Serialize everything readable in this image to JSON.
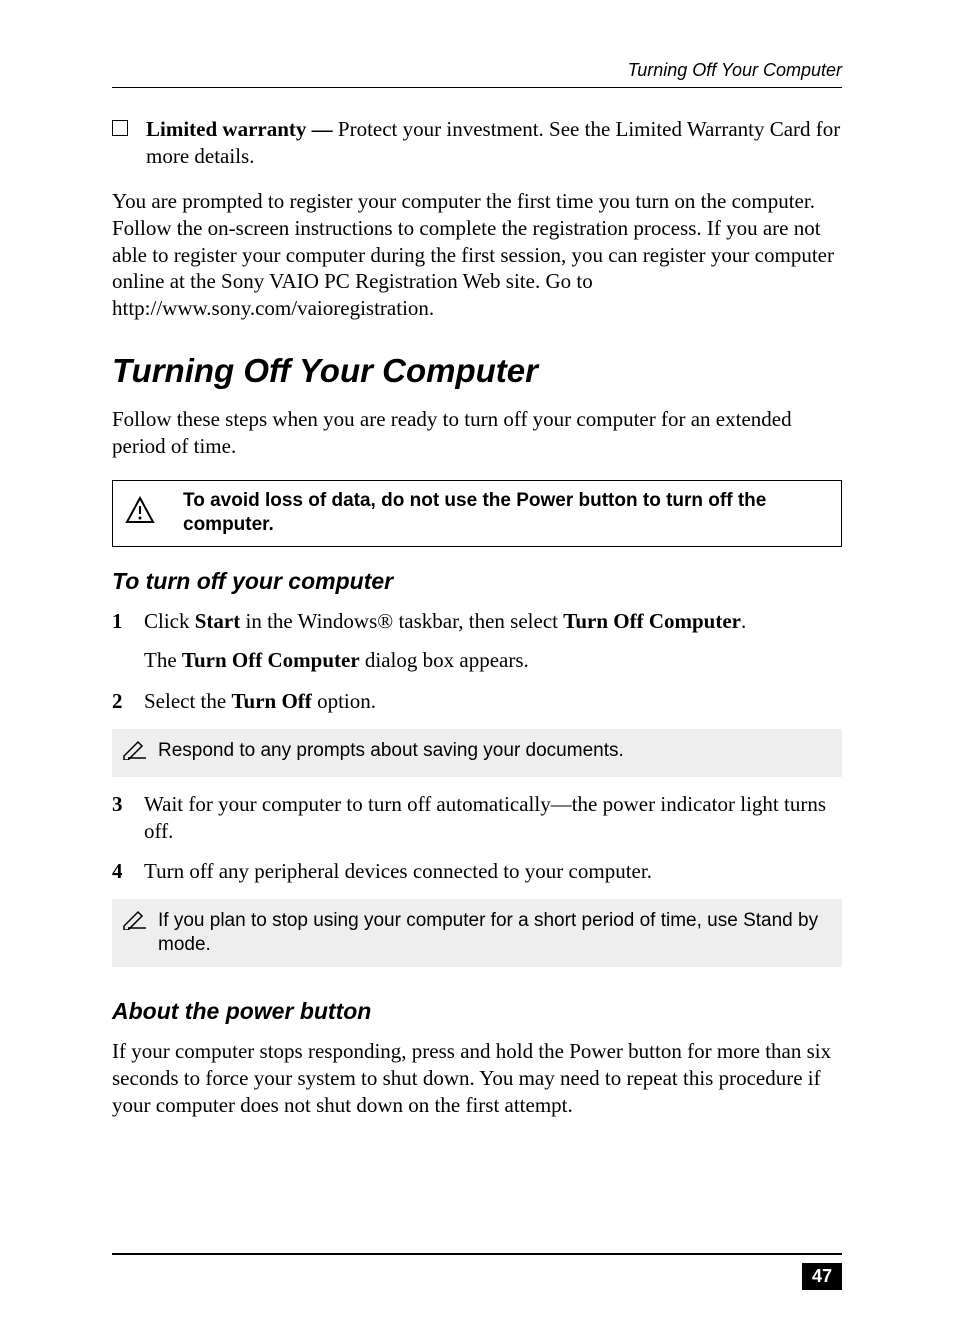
{
  "runningHead": "Turning Off Your Computer",
  "bullet": {
    "lead": "Limited warranty — ",
    "rest": "Protect your investment. See the Limited Warranty Card for more details."
  },
  "intro": "You are prompted to register your computer the first time you turn on the computer. Follow the on-screen instructions to complete the registration process. If you are not able to register your computer during the first session, you can register your computer online at the Sony VAIO PC Registration Web site. Go to http://www.sony.com/vaioregistration.",
  "h1": "Turning Off Your Computer",
  "h1_intro": "Follow these steps when you are ready to turn off your computer for an extended period of time.",
  "warning": "To avoid loss of data, do not use the Power button to turn off the computer.",
  "h2a": "To turn off your computer",
  "steps": {
    "s1_pre": "Click ",
    "s1_b1": "Start",
    "s1_mid": " in the Windows® taskbar, then select ",
    "s1_b2": "Turn Off Computer",
    "s1_post": ".",
    "s1_sub_pre": "The ",
    "s1_sub_b": "Turn Off Computer",
    "s1_sub_post": " dialog box appears.",
    "s2_pre": "Select the ",
    "s2_b": "Turn Off",
    "s2_post": " option.",
    "s3": "Wait for your computer to turn off automatically—the power indicator light turns off.",
    "s4": "Turn off any peripheral devices connected to your computer."
  },
  "note1": "Respond to any prompts about saving your documents.",
  "note2": "If you plan to stop using your computer for a short period of time, use Stand by mode.",
  "h2b": "About the power button",
  "about": "If your computer stops responding, press and hold the Power button for more than six seconds to force your system to shut down. You may need to repeat this procedure if your computer does not shut down on the first attempt.",
  "pageNumber": "47",
  "nums": {
    "n1": "1",
    "n2": "2",
    "n3": "3",
    "n4": "4"
  }
}
